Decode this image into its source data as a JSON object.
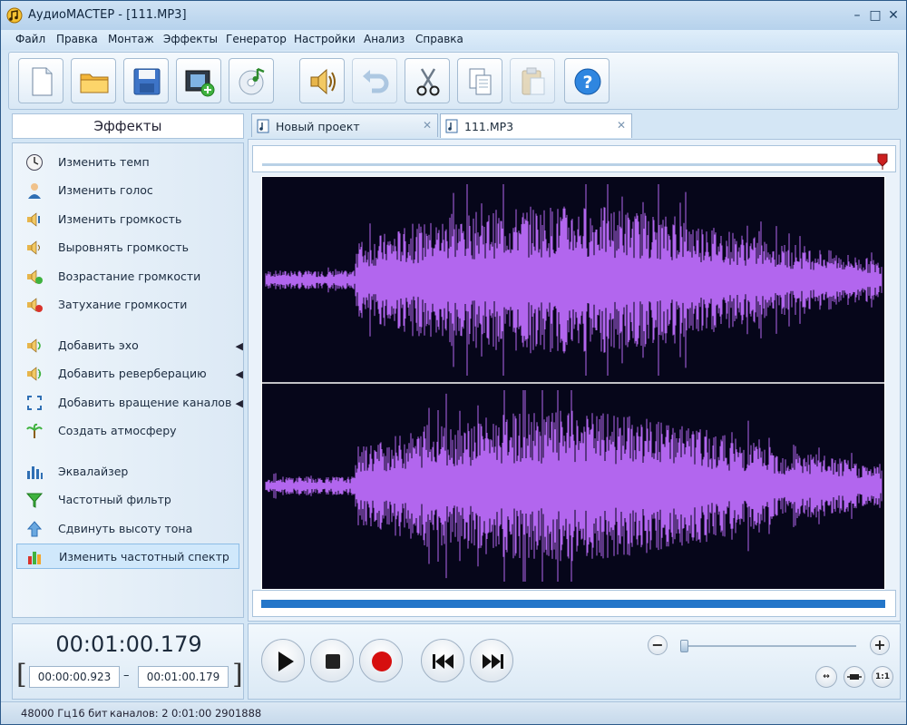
{
  "window": {
    "title": "АудиоМАСТЕР - [111.MP3]",
    "controls": [
      "minimize",
      "maximize",
      "close"
    ]
  },
  "menu": [
    "Файл",
    "Правка",
    "Монтаж",
    "Эффекты",
    "Генератор",
    "Настройки",
    "Анализ",
    "Справка"
  ],
  "toolbar": [
    {
      "name": "new-file",
      "icon": "page-icon",
      "enabled": true
    },
    {
      "name": "open-folder",
      "icon": "folder-icon",
      "enabled": true
    },
    {
      "name": "save",
      "icon": "floppy-icon",
      "enabled": true
    },
    {
      "name": "add-video",
      "icon": "film-add-icon",
      "enabled": true
    },
    {
      "name": "cd-music",
      "icon": "cd-music-icon",
      "enabled": true
    },
    {
      "name": "volume",
      "icon": "speaker-icon",
      "enabled": true
    },
    {
      "name": "undo",
      "icon": "undo-icon",
      "enabled": false
    },
    {
      "name": "cut",
      "icon": "scissors-icon",
      "enabled": true
    },
    {
      "name": "copy",
      "icon": "copy-icon",
      "enabled": true
    },
    {
      "name": "paste",
      "icon": "paste-icon",
      "enabled": false
    },
    {
      "name": "help",
      "icon": "help-icon",
      "enabled": true
    }
  ],
  "effects": {
    "header": "Эффекты",
    "items": [
      {
        "label": "Изменить темп",
        "icon": "clock-icon",
        "submenu": false
      },
      {
        "label": "Изменить голос",
        "icon": "person-voice-icon",
        "submenu": false
      },
      {
        "label": "Изменить громкость",
        "icon": "volume-change-icon",
        "submenu": false
      },
      {
        "label": "Выровнять громкость",
        "icon": "volume-level-icon",
        "submenu": false
      },
      {
        "label": "Возрастание громкости",
        "icon": "fade-in-icon",
        "submenu": false
      },
      {
        "label": "Затухание громкости",
        "icon": "fade-out-icon",
        "submenu": false
      },
      {
        "label": "Добавить эхо",
        "icon": "echo-icon",
        "submenu": true
      },
      {
        "label": "Добавить реверберацию",
        "icon": "reverb-icon",
        "submenu": true
      },
      {
        "label": "Добавить вращение каналов",
        "icon": "rotate-channels-icon",
        "submenu": true
      },
      {
        "label": "Создать атмосферу",
        "icon": "atmosphere-icon",
        "submenu": true
      },
      {
        "label": "Эквалайзер",
        "icon": "equalizer-icon",
        "submenu": false
      },
      {
        "label": "Частотный фильтр",
        "icon": "filter-icon",
        "submenu": false
      },
      {
        "label": "Сдвинуть высоту тона",
        "icon": "pitch-up-icon",
        "submenu": false
      },
      {
        "label": "Изменить частотный спектр",
        "icon": "spectrum-icon",
        "submenu": false,
        "selected": true
      }
    ]
  },
  "tabs": [
    {
      "label": "Новый проект",
      "active": false
    },
    {
      "label": "111.MP3",
      "active": true
    }
  ],
  "waveform": {
    "color": "#b266ee",
    "background": "#06061a",
    "channels": 2
  },
  "time": {
    "current": "00:01:00.179",
    "selection_start": "00:00:00.923",
    "selection_end": "00:01:00.179"
  },
  "transport": [
    "play",
    "stop",
    "record",
    "rewind",
    "fast-forward"
  ],
  "zoom": {
    "minus": "−",
    "plus": "+",
    "level_fraction": 0.0,
    "fit_labels": [
      "↔",
      "",
      "1:1"
    ]
  },
  "status": {
    "sample_rate": "48000 Гц",
    "bits": "16 бит",
    "channels": "каналов: 2",
    "duration": "0:01:00 2901888"
  }
}
